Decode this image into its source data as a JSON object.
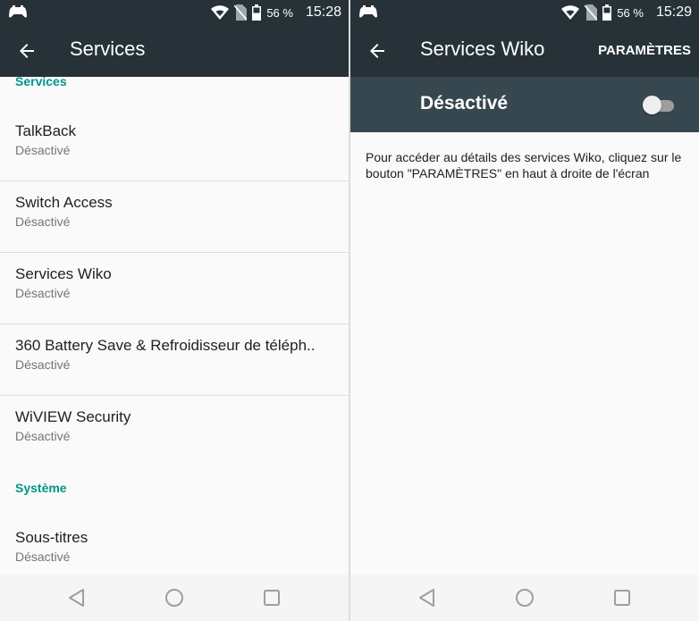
{
  "left": {
    "status": {
      "battery": "56 %",
      "time": "15:28"
    },
    "appbar": {
      "title": "Services"
    },
    "sections": [
      {
        "header": "Services",
        "items": [
          {
            "title": "TalkBack",
            "subtitle": "Désactivé"
          },
          {
            "title": "Switch Access",
            "subtitle": "Désactivé"
          },
          {
            "title": "Services Wiko",
            "subtitle": "Désactivé"
          },
          {
            "title": "360 Battery Save & Refroidisseur de téléph..",
            "subtitle": "Désactivé"
          },
          {
            "title": "WiVIEW Security",
            "subtitle": "Désactivé"
          }
        ]
      },
      {
        "header": "Système",
        "items": [
          {
            "title": "Sous-titres",
            "subtitle": "Désactivé"
          }
        ]
      }
    ]
  },
  "right": {
    "status": {
      "battery": "56 %",
      "time": "15:29"
    },
    "appbar": {
      "title": "Services Wiko",
      "action": "PARAMÈTRES"
    },
    "switch": {
      "label": "Désactivé",
      "on": false
    },
    "description": "Pour accéder au détails des services Wiko, cliquez sur le bouton \"PARAMÈTRES\" en haut à droite de l'écran"
  },
  "colors": {
    "appbar": "#263238",
    "switchbar": "#37474f",
    "accent": "#009688",
    "background": "#fafafa"
  },
  "icons": [
    "game-controller-icon",
    "wifi-icon",
    "no-sim-icon",
    "battery-icon",
    "back-arrow-icon",
    "nav-back-icon",
    "nav-home-icon",
    "nav-recents-icon"
  ]
}
